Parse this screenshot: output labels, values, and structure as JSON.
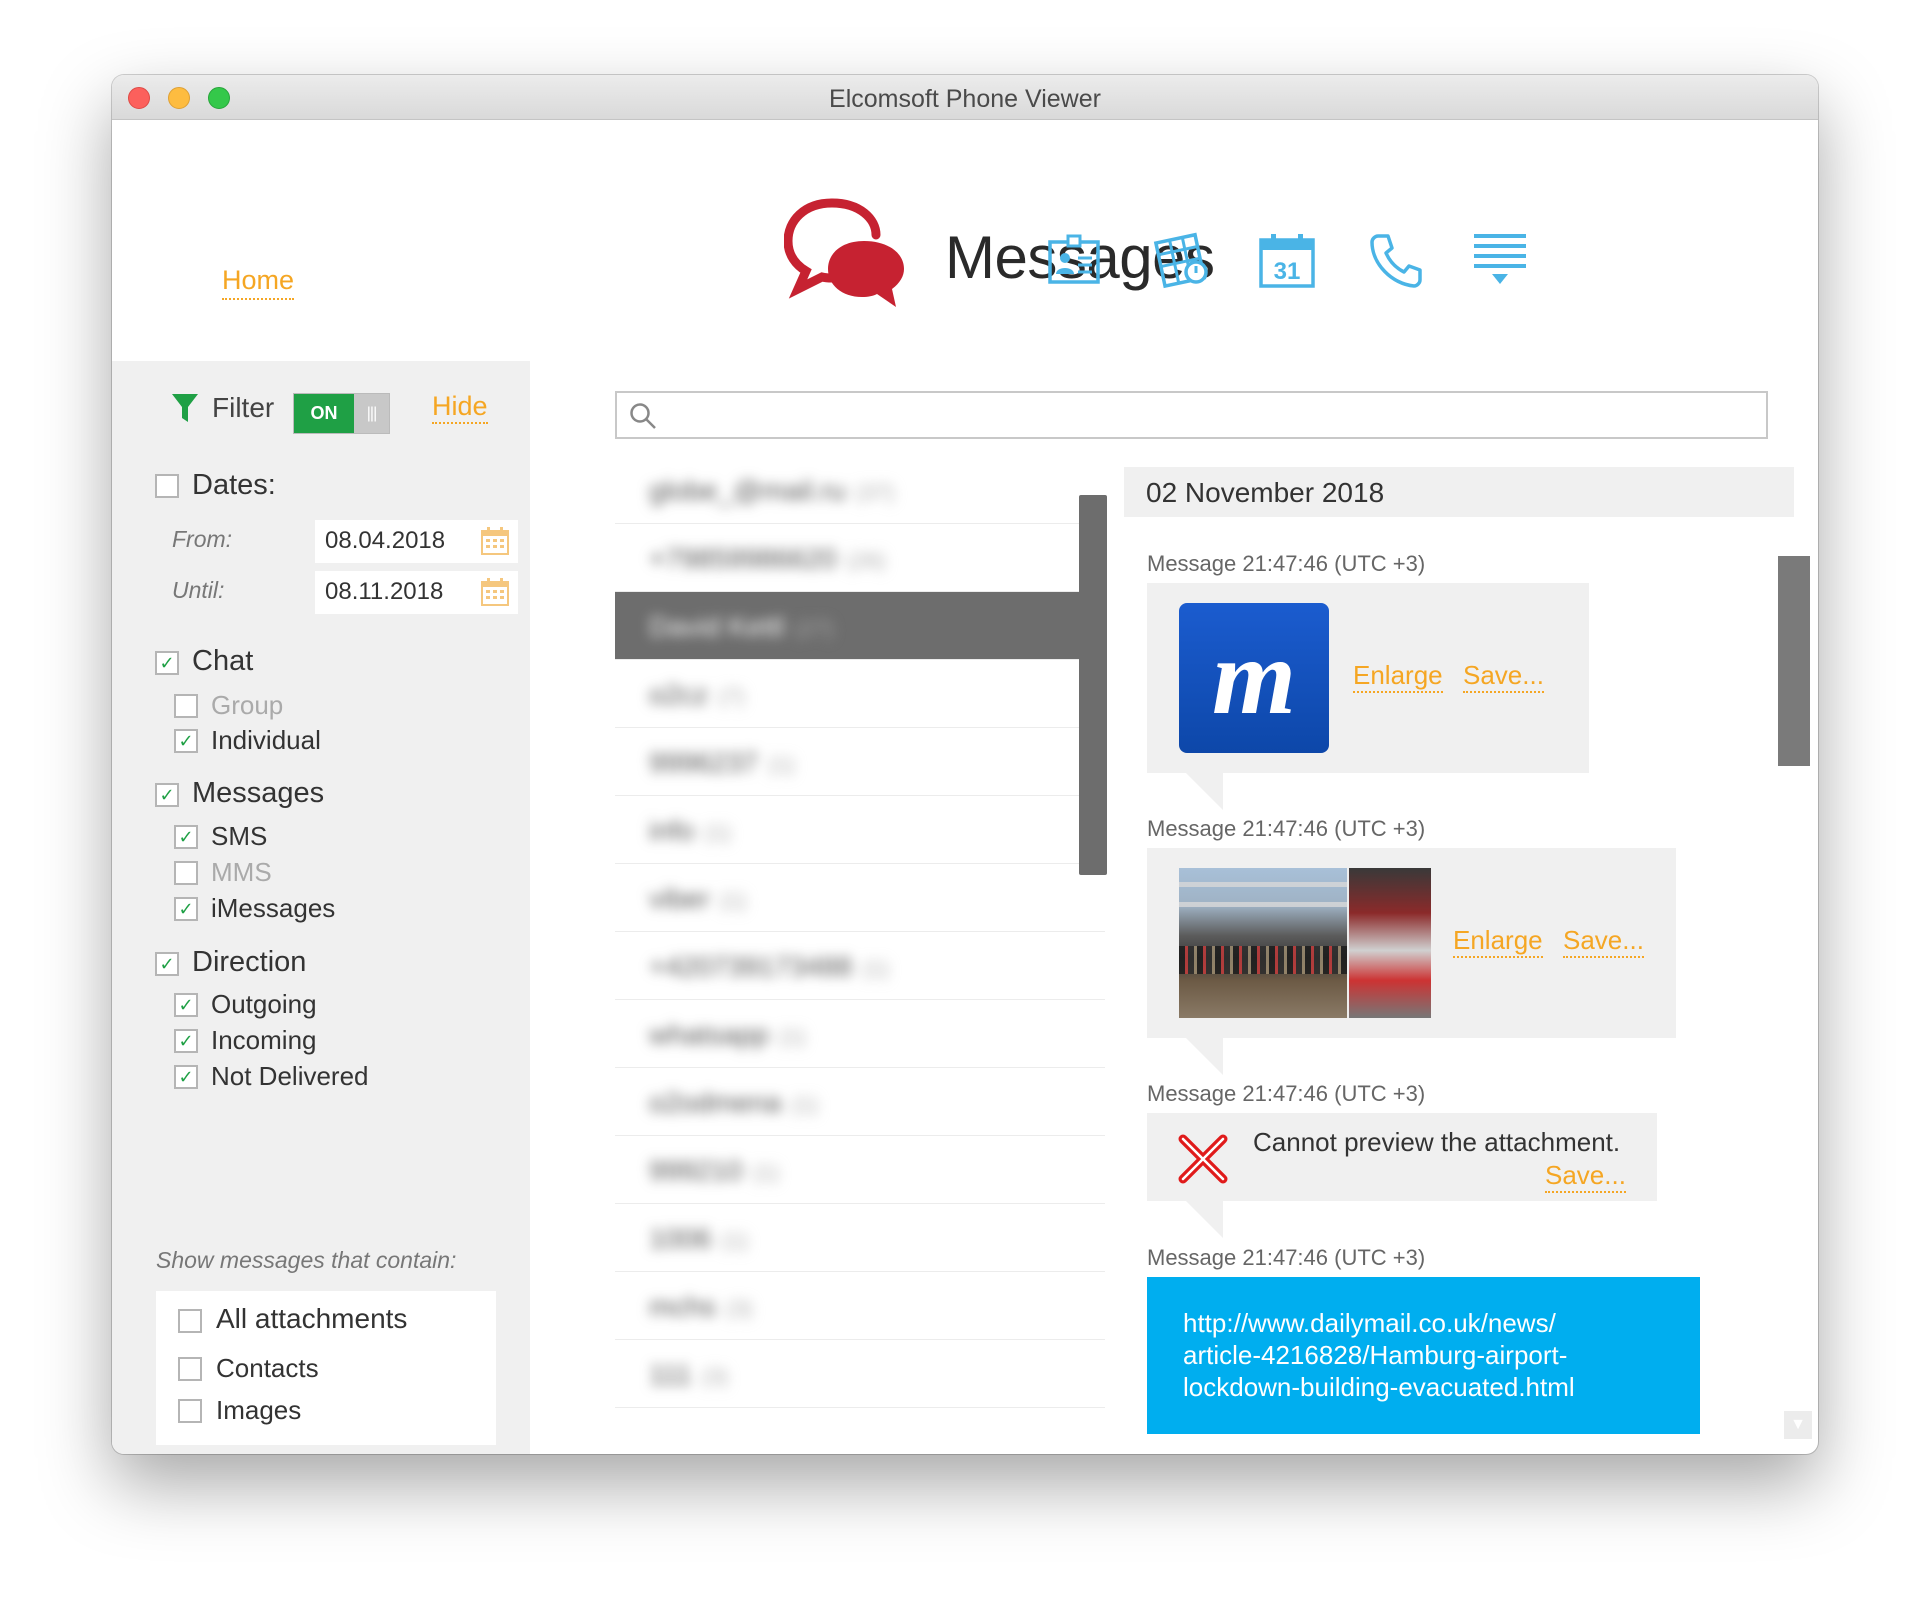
{
  "window": {
    "title": "Elcomsoft Phone Viewer"
  },
  "nav": {
    "home_label": "Home",
    "page_title": "Messages",
    "icons": [
      "contacts-icon",
      "notes-icon",
      "calendar-icon",
      "phone-icon",
      "menu-icon"
    ],
    "calendar_day": "31"
  },
  "colors": {
    "accent": "#f5a623",
    "toggle_on": "#1fa045",
    "icon_blue": "#4ab4e6",
    "logo_red": "#c62231",
    "link_bubble": "#00aeef"
  },
  "filter": {
    "label": "Filter",
    "toggle_label": "ON",
    "hide_label": "Hide",
    "dates": {
      "label": "Dates:",
      "checked": false,
      "from_label": "From:",
      "from_value": "08.04.2018",
      "until_label": "Until:",
      "until_value": "08.11.2018"
    },
    "chat": {
      "label": "Chat",
      "checked": true,
      "group": {
        "label": "Group",
        "checked": false
      },
      "individual": {
        "label": "Individual",
        "checked": true
      }
    },
    "messages": {
      "label": "Messages",
      "checked": true,
      "sms": {
        "label": "SMS",
        "checked": true
      },
      "mms": {
        "label": "MMS",
        "checked": false
      },
      "imessages": {
        "label": "iMessages",
        "checked": true
      }
    },
    "direction": {
      "label": "Direction",
      "checked": true,
      "outgoing": {
        "label": "Outgoing",
        "checked": true
      },
      "incoming": {
        "label": "Incoming",
        "checked": true
      },
      "not_delivered": {
        "label": "Not Delivered",
        "checked": true
      }
    },
    "contains_label": "Show messages that contain:",
    "all_attachments": {
      "label": "All attachments",
      "checked": false
    },
    "contacts": {
      "label": "Contacts",
      "checked": false
    },
    "images": {
      "label": "Images",
      "checked": false
    }
  },
  "search": {
    "placeholder": "",
    "value": ""
  },
  "conversations": [
    {
      "name": "globe_@mail.ru",
      "count": "(37)"
    },
    {
      "name": "+79859986620",
      "count": "(26)"
    },
    {
      "name": "David Kettl",
      "count": "(27)",
      "selected": true
    },
    {
      "name": "o2cz",
      "count": "(7)"
    },
    {
      "name": "9996237",
      "count": "(1)"
    },
    {
      "name": "info",
      "count": "(1)"
    },
    {
      "name": "viber",
      "count": "(1)"
    },
    {
      "name": "+420739173488",
      "count": "(1)"
    },
    {
      "name": "whatsapp",
      "count": "(1)"
    },
    {
      "name": "o2odmena",
      "count": "(1)"
    },
    {
      "name": "999210",
      "count": "(1)"
    },
    {
      "name": "1006",
      "count": "(1)"
    },
    {
      "name": "mchs",
      "count": "(3)"
    },
    {
      "name": "111",
      "count": "(3)"
    }
  ],
  "thread": {
    "date_header": "02 November 2018",
    "messages": [
      {
        "timestamp": "Message 21:47:46 (UTC +3)",
        "enlarge": "Enlarge",
        "save": "Save...",
        "logo_letter": "m"
      },
      {
        "timestamp": "Message 21:47:46 (UTC +3)",
        "enlarge": "Enlarge",
        "save": "Save..."
      },
      {
        "timestamp": "Message 21:47:46 (UTC +3)",
        "no_preview": "Cannot preview the attachment.",
        "save": "Save..."
      },
      {
        "timestamp": "Message 21:47:46 (UTC +3)",
        "link_lines": [
          "http://www.dailymail.co.uk/news/",
          "article-4216828/Hamburg-airport-",
          "lockdown-building-evacuated.html"
        ]
      }
    ]
  }
}
